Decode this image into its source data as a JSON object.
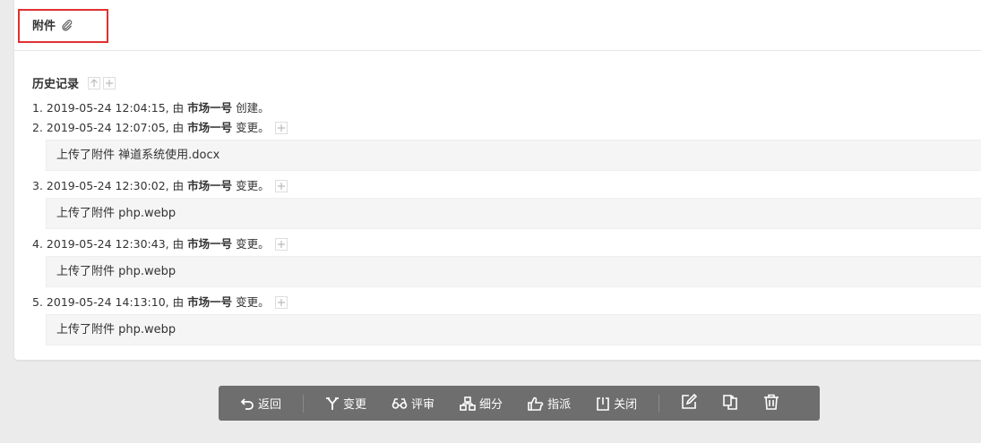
{
  "attachments": {
    "title": "附件"
  },
  "history": {
    "title": "历史记录",
    "entries": [
      {
        "index": "1.",
        "timestamp": "2019-05-24 12:04:15,",
        "by": "由",
        "user": "市场一号",
        "action": "创建。",
        "detail": ""
      },
      {
        "index": "2.",
        "timestamp": "2019-05-24 12:07:05,",
        "by": "由",
        "user": "市场一号",
        "action": "变更。",
        "detail": "上传了附件 禅道系统使用.docx"
      },
      {
        "index": "3.",
        "timestamp": "2019-05-24 12:30:02,",
        "by": "由",
        "user": "市场一号",
        "action": "变更。",
        "detail": "上传了附件 php.webp"
      },
      {
        "index": "4.",
        "timestamp": "2019-05-24 12:30:43,",
        "by": "由",
        "user": "市场一号",
        "action": "变更。",
        "detail": "上传了附件 php.webp"
      },
      {
        "index": "5.",
        "timestamp": "2019-05-24 14:13:10,",
        "by": "由",
        "user": "市场一号",
        "action": "变更。",
        "detail": "上传了附件 php.webp"
      }
    ]
  },
  "toolbar": {
    "back": "返回",
    "change": "变更",
    "review": "评审",
    "subdivide": "细分",
    "assign": "指派",
    "close": "关闭"
  },
  "colors": {
    "highlight_border": "#e03131",
    "toolbar_bg": "#6e6e6e"
  }
}
